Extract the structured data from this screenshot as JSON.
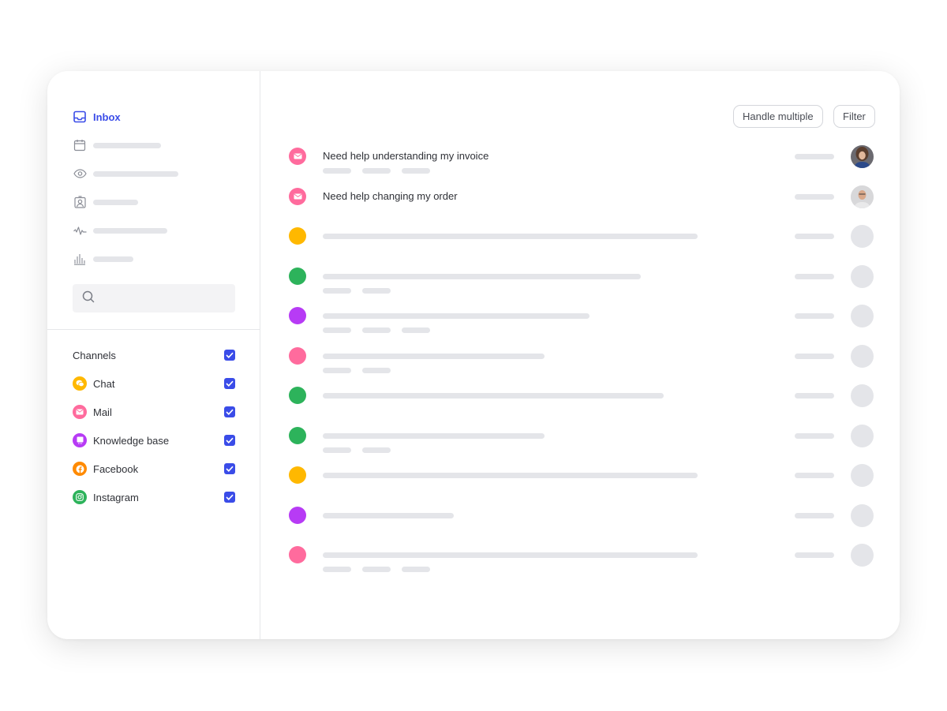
{
  "sidebar": {
    "nav": [
      {
        "icon": "inbox-icon",
        "label": "Inbox",
        "active": true
      },
      {
        "icon": "calendar-icon",
        "label": null
      },
      {
        "icon": "eye-icon",
        "label": null
      },
      {
        "icon": "contact-icon",
        "label": null
      },
      {
        "icon": "activity-icon",
        "label": null
      },
      {
        "icon": "bar-chart-icon",
        "label": null
      }
    ],
    "search": {
      "placeholder": "",
      "value": ""
    },
    "channels": {
      "header": "Channels",
      "all_checked": true,
      "items": [
        {
          "label": "Chat",
          "icon": "chat-icon",
          "color": "#FFB800",
          "checked": true
        },
        {
          "label": "Mail",
          "icon": "mail-icon",
          "color": "#FF6B9D",
          "checked": true
        },
        {
          "label": "Knowledge base",
          "icon": "book-icon",
          "color": "#B73BF5",
          "checked": true
        },
        {
          "label": "Facebook",
          "icon": "facebook-icon",
          "color": "#FF8A00",
          "checked": true
        },
        {
          "label": "Instagram",
          "icon": "instagram-icon",
          "color": "#2DB35B",
          "checked": true
        }
      ]
    }
  },
  "toolbar": {
    "handle_multiple_label": "Handle multiple",
    "filter_label": "Filter"
  },
  "colors": {
    "accent": "#3A4CE8",
    "skeleton": "#E4E5E9",
    "yellow": "#FFB800",
    "green": "#2DB35B",
    "purple": "#B73BF5",
    "pink": "#FF6B9D"
  },
  "conversations": [
    {
      "channel": "mail",
      "color": "#FF6B9D",
      "title": "Need help understanding my invoice",
      "tags": 3,
      "avatar": "woman"
    },
    {
      "channel": "mail",
      "color": "#FF6B9D",
      "title": "Need help changing my order",
      "tags": 0,
      "avatar": "man"
    },
    {
      "channel": "chat",
      "color": "#FFB800",
      "title": null,
      "tags": 0
    },
    {
      "channel": "instagram",
      "color": "#2DB35B",
      "title": null,
      "tags": 2
    },
    {
      "channel": "knowledge-base",
      "color": "#B73BF5",
      "title": null,
      "tags": 3
    },
    {
      "channel": "mail",
      "color": "#FF6B9D",
      "title": null,
      "tags": 2
    },
    {
      "channel": "instagram",
      "color": "#2DB35B",
      "title": null,
      "tags": 0
    },
    {
      "channel": "instagram",
      "color": "#2DB35B",
      "title": null,
      "tags": 2
    },
    {
      "channel": "chat",
      "color": "#FFB800",
      "title": null,
      "tags": 0
    },
    {
      "channel": "knowledge-base",
      "color": "#B73BF5",
      "title": null,
      "tags": 0
    },
    {
      "channel": "mail",
      "color": "#FF6B9D",
      "title": null,
      "tags": 3
    }
  ]
}
